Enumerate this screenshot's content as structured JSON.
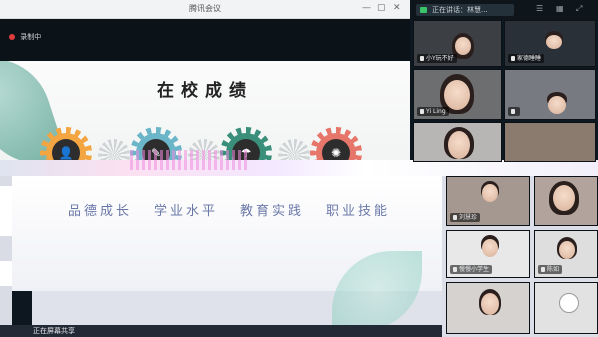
{
  "window": {
    "title": "腾讯会议"
  },
  "recording": {
    "label": "录制中"
  },
  "slide": {
    "title": "在校成绩",
    "categories": [
      "品德成长",
      "学业水平",
      "教育实践",
      "职业技能"
    ],
    "icons": [
      "person-icon",
      "book-person-icon",
      "umbrella-icon",
      "lightbulb-icon"
    ]
  },
  "screen_share": {
    "label": "正在屏幕共享"
  },
  "video_panel": {
    "header_label": "正在讲话：林慧..."
  },
  "participants": [
    {
      "name": "小Y玩不好"
    },
    {
      "name": "家德睡睡"
    },
    {
      "name": "Yi Ling"
    },
    {
      "name": ""
    },
    {
      "name": ""
    },
    {
      "name": "刘慧珍"
    },
    {
      "name": ""
    },
    {
      "name": "慢慢小学生"
    },
    {
      "name": "陈如"
    },
    {
      "name": ""
    },
    {
      "name": ""
    }
  ]
}
